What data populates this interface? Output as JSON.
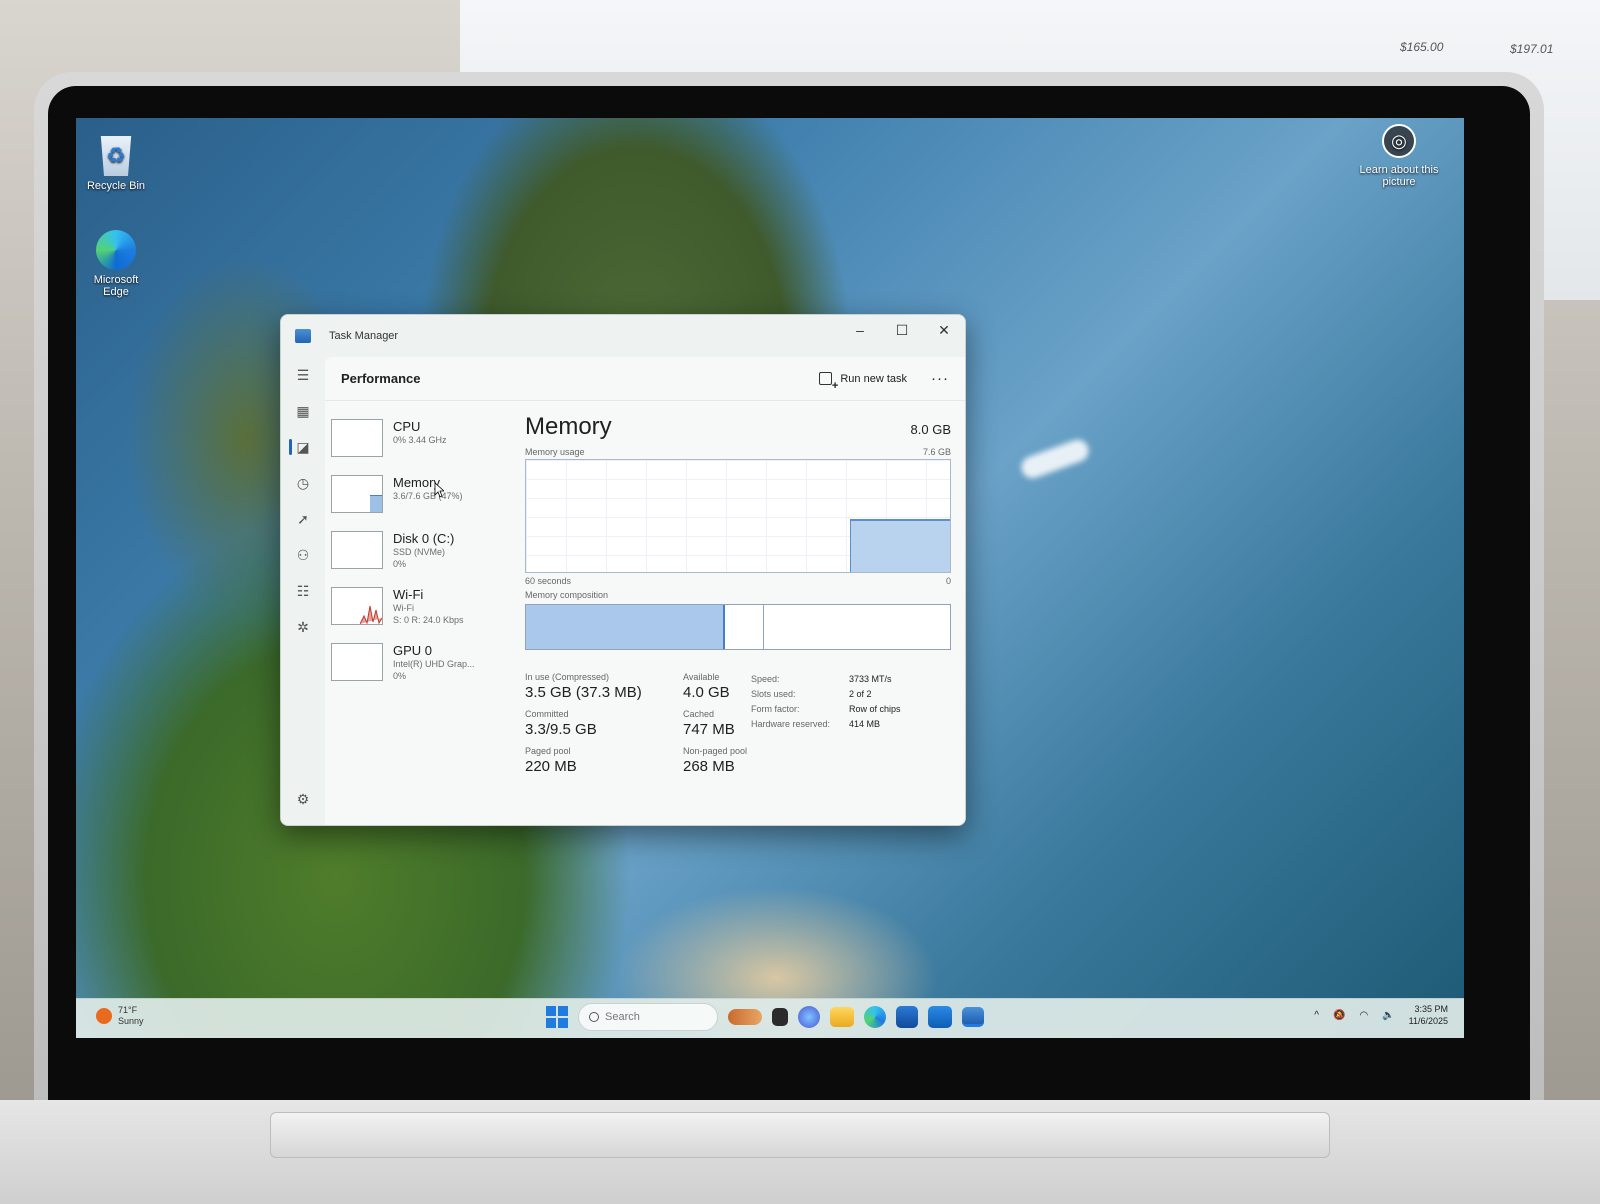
{
  "background_monitor": {
    "values": [
      "$165.00",
      "$197.01"
    ]
  },
  "desktop": {
    "icons": [
      {
        "label": "Recycle Bin"
      },
      {
        "label": "Microsoft Edge"
      }
    ],
    "learn_picture": "Learn about this picture"
  },
  "task_manager": {
    "window_title": "Task Manager",
    "controls": {
      "minimize": "–",
      "maximize": "☐",
      "close": "✕"
    },
    "section_title": "Performance",
    "run_new_task": "Run new task",
    "more": "···",
    "perf_items": [
      {
        "name": "CPU",
        "sub1": "0% 3.44 GHz",
        "sub2": "",
        "sub3": ""
      },
      {
        "name": "Memory",
        "sub1": "3.6/7.6 GB (47%)",
        "sub2": "",
        "sub3": ""
      },
      {
        "name": "Disk 0 (C:)",
        "sub1": "SSD (NVMe)",
        "sub2": "0%",
        "sub3": ""
      },
      {
        "name": "Wi-Fi",
        "sub1": "Wi-Fi",
        "sub2": "S: 0 R: 24.0 Kbps",
        "sub3": ""
      },
      {
        "name": "GPU 0",
        "sub1": "Intel(R) UHD Grap...",
        "sub2": "0%",
        "sub3": ""
      }
    ],
    "memory": {
      "title": "Memory",
      "total": "8.0 GB",
      "usage_label": "Memory usage",
      "usage_max": "7.6 GB",
      "time_left": "60 seconds",
      "time_right": "0",
      "usage_fraction": 0.47,
      "composition_label": "Memory composition",
      "in_use_fraction": 0.47,
      "in_use_label": "In use (Compressed)",
      "in_use_value": "3.5 GB (37.3 MB)",
      "available_label": "Available",
      "available_value": "4.0 GB",
      "committed_label": "Committed",
      "committed_value": "3.3/9.5 GB",
      "cached_label": "Cached",
      "cached_value": "747 MB",
      "paged_label": "Paged pool",
      "paged_value": "220 MB",
      "nonpaged_label": "Non-paged pool",
      "nonpaged_value": "268 MB",
      "specs": [
        {
          "label": "Speed:",
          "value": "3733 MT/s"
        },
        {
          "label": "Slots used:",
          "value": "2 of 2"
        },
        {
          "label": "Form factor:",
          "value": "Row of chips"
        },
        {
          "label": "Hardware reserved:",
          "value": "414 MB"
        }
      ]
    }
  },
  "taskbar": {
    "weather_temp": "71°F",
    "weather_cond": "Sunny",
    "search_placeholder": "Search",
    "time": "3:35 PM",
    "date": "11/6/2025",
    "tray_chevron": "^"
  },
  "colors": {
    "accent": "#2266b3",
    "memory_fill": "#aac8ec",
    "windows_blue": "#1f7be0"
  }
}
